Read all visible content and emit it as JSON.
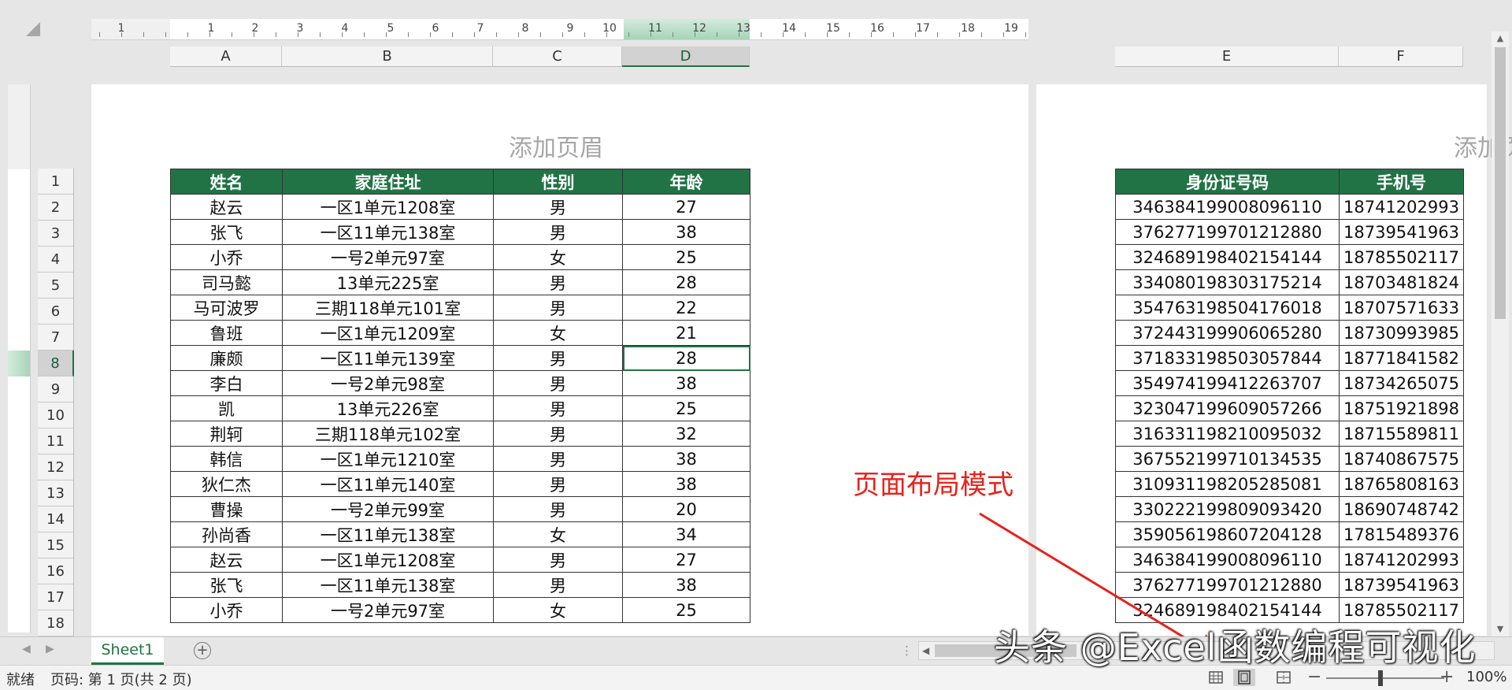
{
  "ruler": {
    "numbers": [
      "1",
      "1",
      "2",
      "3",
      "4",
      "5",
      "6",
      "7",
      "8",
      "9",
      "10",
      "11",
      "12",
      "13",
      "14",
      "15",
      "16",
      "17",
      "18",
      "19"
    ]
  },
  "columns_left": [
    "A",
    "B",
    "C",
    "D"
  ],
  "columns_right": [
    "E",
    "F"
  ],
  "row_numbers": [
    "1",
    "2",
    "3",
    "4",
    "5",
    "6",
    "7",
    "8",
    "9",
    "10",
    "11",
    "12",
    "13",
    "14",
    "15",
    "16",
    "17",
    "18"
  ],
  "page_header": {
    "placeholder": "添加页眉"
  },
  "table_left": {
    "headers": [
      "姓名",
      "家庭住址",
      "性别",
      "年龄"
    ],
    "rows": [
      [
        "赵云",
        "一区1单元1208室",
        "男",
        "27"
      ],
      [
        "张飞",
        "一区11单元138室",
        "男",
        "38"
      ],
      [
        "小乔",
        "一号2单元97室",
        "女",
        "25"
      ],
      [
        "司马懿",
        "13单元225室",
        "男",
        "28"
      ],
      [
        "马可波罗",
        "三期118单元101室",
        "男",
        "22"
      ],
      [
        "鲁班",
        "一区1单元1209室",
        "女",
        "21"
      ],
      [
        "廉颇",
        "一区11单元139室",
        "男",
        "28"
      ],
      [
        "李白",
        "一号2单元98室",
        "男",
        "38"
      ],
      [
        "凯",
        "13单元226室",
        "男",
        "25"
      ],
      [
        "荆轲",
        "三期118单元102室",
        "男",
        "32"
      ],
      [
        "韩信",
        "一区1单元1210室",
        "男",
        "38"
      ],
      [
        "狄仁杰",
        "一区11单元140室",
        "男",
        "38"
      ],
      [
        "曹操",
        "一号2单元99室",
        "男",
        "20"
      ],
      [
        "孙尚香",
        "一区11单元138室",
        "女",
        "34"
      ],
      [
        "赵云",
        "一区1单元1208室",
        "男",
        "27"
      ],
      [
        "张飞",
        "一区11单元138室",
        "男",
        "38"
      ],
      [
        "小乔",
        "一号2单元97室",
        "女",
        "25"
      ]
    ]
  },
  "table_right": {
    "headers": [
      "身份证号码",
      "手机号"
    ],
    "rows": [
      [
        "346384199008096110",
        "18741202993"
      ],
      [
        "376277199701212880",
        "18739541963"
      ],
      [
        "324689198402154144",
        "18785502117"
      ],
      [
        "334080198303175214",
        "18703481824"
      ],
      [
        "354763198504176018",
        "18707571633"
      ],
      [
        "372443199906065280",
        "18730993985"
      ],
      [
        "371833198503057844",
        "18771841582"
      ],
      [
        "354974199412263707",
        "18734265075"
      ],
      [
        "323047199609057266",
        "18751921898"
      ],
      [
        "316331198210095032",
        "18715589811"
      ],
      [
        "367552199710134535",
        "18740867575"
      ],
      [
        "310931198205285081",
        "18765808163"
      ],
      [
        "330222199809093420",
        "18690748742"
      ],
      [
        "359056198607204128",
        "17815489376"
      ],
      [
        "346384199008096110",
        "18741202993"
      ],
      [
        "376277199701212880",
        "18739541963"
      ],
      [
        "324689198402154144",
        "18785502117"
      ]
    ]
  },
  "annotation": {
    "text": "页面布局模式",
    "color": "#e8221b"
  },
  "sheet_tab": {
    "label": "Sheet1"
  },
  "status": {
    "ready": "就绪",
    "page_info": "页码: 第 1 页(共 2 页)",
    "zoom": "100%"
  },
  "watermark": "头条 @Excel函数编程可视化",
  "colors": {
    "accent": "#217346",
    "header_text": "#ffffff",
    "annotation": "#e8221b"
  },
  "selection": {
    "active_cell": "D8"
  }
}
